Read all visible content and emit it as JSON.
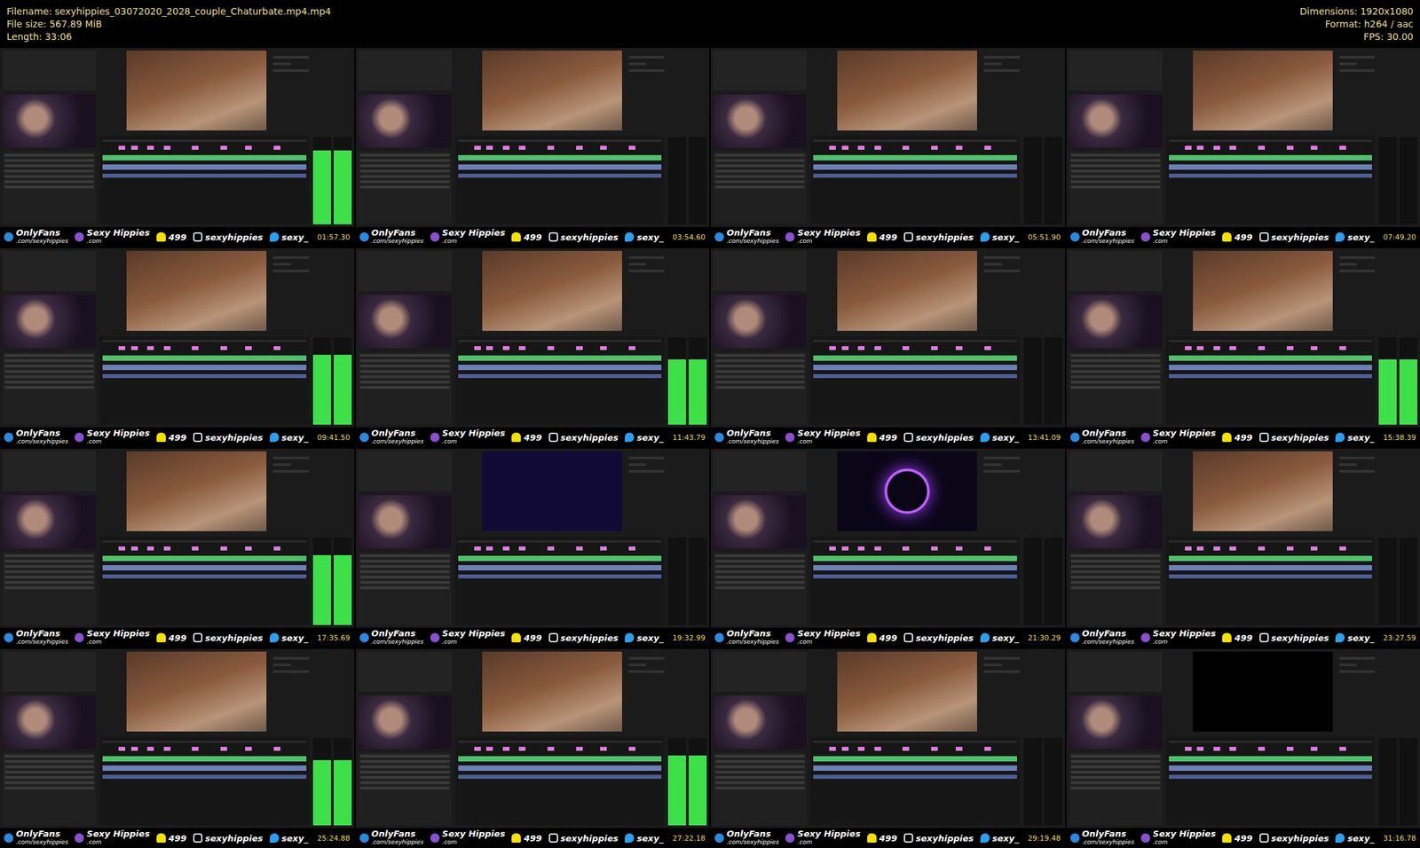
{
  "header": {
    "left": [
      "Filename: sexyhippies_03072020_2028_couple_Chaturbate.mp4.mp4",
      "File size: 567.89 MiB",
      "Length: 33:06"
    ],
    "right": [
      "Dimensions: 1920x1080",
      "Format: h264 / aac",
      "FPS: 30.00"
    ]
  },
  "footer": {
    "onlyfans": "OnlyFans",
    "onlyfans_url": ".com/sexyhippies",
    "brand": "Sexy Hippies",
    "brand_url": ".com",
    "snap": "499",
    "instagram": "sexyhippies",
    "twitter": "sexy_"
  },
  "tiles": [
    {
      "time": "01:57.30",
      "kind": "canyon",
      "meter_level": 0.85
    },
    {
      "time": "03:54.60",
      "kind": "canyon",
      "meter_level": 0
    },
    {
      "time": "05:51.90",
      "kind": "canyon",
      "meter_level": 0
    },
    {
      "time": "07:49.20",
      "kind": "canyon",
      "meter_level": 0
    },
    {
      "time": "09:41.50",
      "kind": "canyon",
      "meter_level": 0.8
    },
    {
      "time": "11:43.79",
      "kind": "canyon",
      "meter_level": 0.75
    },
    {
      "time": "13:41.09",
      "kind": "canyon",
      "meter_level": 0
    },
    {
      "time": "15:38.39",
      "kind": "canyon",
      "meter_level": 0.75
    },
    {
      "time": "17:35.69",
      "kind": "canyon",
      "meter_level": 0.8
    },
    {
      "time": "19:32.99",
      "kind": "dark",
      "meter_level": 0
    },
    {
      "time": "21:30.29",
      "kind": "logo",
      "meter_level": 0
    },
    {
      "time": "23:27.59",
      "kind": "canyon",
      "meter_level": 0
    },
    {
      "time": "25:24.88",
      "kind": "canyon",
      "meter_level": 0.75
    },
    {
      "time": "27:22.18",
      "kind": "canyon",
      "meter_level": 0.8
    },
    {
      "time": "29:19.48",
      "kind": "canyon",
      "meter_level": 0
    },
    {
      "time": "31:16.78",
      "kind": "black",
      "meter_level": 0
    }
  ]
}
